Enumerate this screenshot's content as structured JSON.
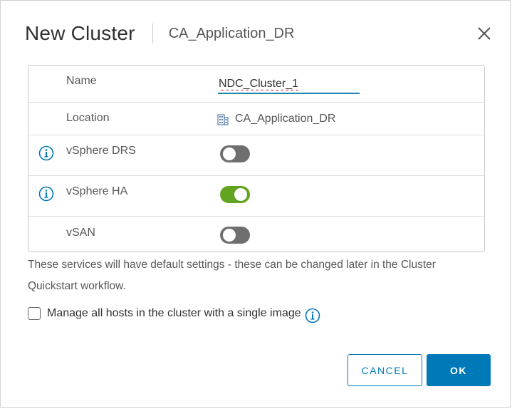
{
  "dialog": {
    "title": "New Cluster",
    "subtitle": "CA_Application_DR",
    "close_icon": "close-icon"
  },
  "form": {
    "name": {
      "label": "Name",
      "value": "NDC_Cluster_1"
    },
    "location": {
      "label": "Location",
      "value": "CA_Application_DR",
      "icon": "datacenter-icon"
    },
    "drs": {
      "label": "vSphere DRS",
      "enabled": false,
      "info_icon": "info-icon"
    },
    "ha": {
      "label": "vSphere HA",
      "enabled": true,
      "info_icon": "info-icon"
    },
    "vsan": {
      "label": "vSAN",
      "enabled": false
    }
  },
  "note": "These services will have default settings - these can be changed later in the Cluster Quickstart workflow.",
  "single_image": {
    "label": "Manage all hosts in the cluster with a single image",
    "checked": false
  },
  "buttons": {
    "cancel": "CANCEL",
    "ok": "OK"
  },
  "colors": {
    "accent": "#0079b8",
    "toggle_on": "#62a420",
    "toggle_off": "#6f6f6f",
    "input_underline": "#1b86b3"
  }
}
